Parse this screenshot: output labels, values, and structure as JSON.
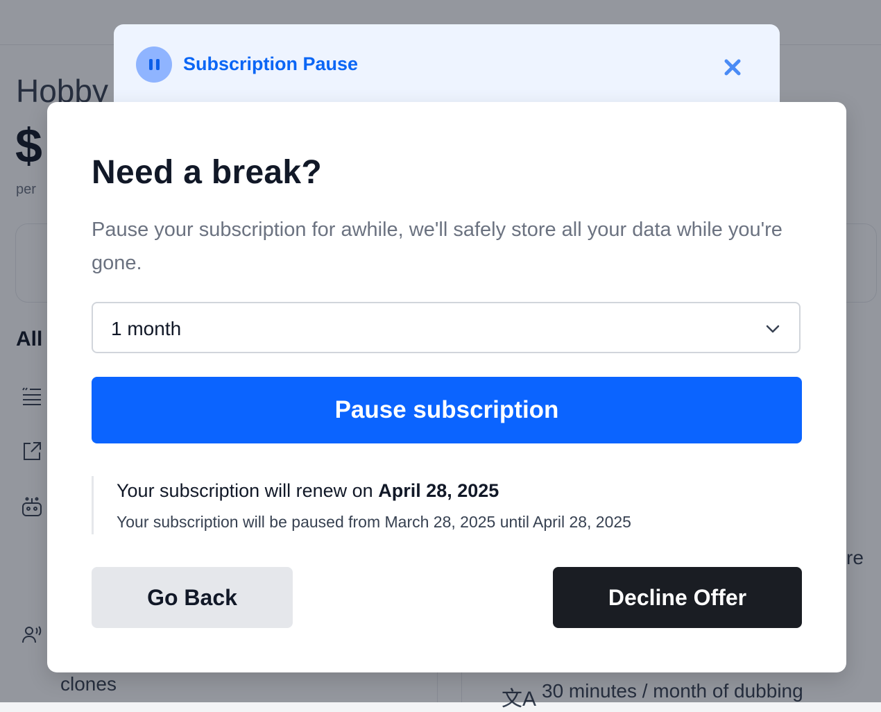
{
  "background": {
    "plan_name": "Hobby",
    "price": "$",
    "per_label": "per",
    "all_heading": "All",
    "clones_text": "clones",
    "dubbing_text": "30 minutes / month of dubbing",
    "partial_text": "re",
    "icons": [
      "quote-list-icon",
      "external-link-icon",
      "robot-icon",
      "voice-user-icon",
      "translate-icon"
    ]
  },
  "header": {
    "title": "Subscription Pause",
    "badge_icon": "pause-icon",
    "close_icon": "close-icon",
    "accent_color": "#0b66f5"
  },
  "modal": {
    "title": "Need a break?",
    "description": "Pause your subscription for awhile, we'll safely store all your data while you're gone.",
    "duration": {
      "selected": "1 month",
      "icon": "chevron-down-icon"
    },
    "pause_button": "Pause subscription",
    "renew_prefix": "Your subscription will renew on ",
    "renew_date": "April 28, 2025",
    "paused_note": "Your subscription will be paused from March 28, 2025 until April 28, 2025",
    "go_back_button": "Go Back",
    "decline_button": "Decline Offer",
    "colors": {
      "primary": "#0b64ff",
      "dark": "#1a1d23"
    }
  }
}
